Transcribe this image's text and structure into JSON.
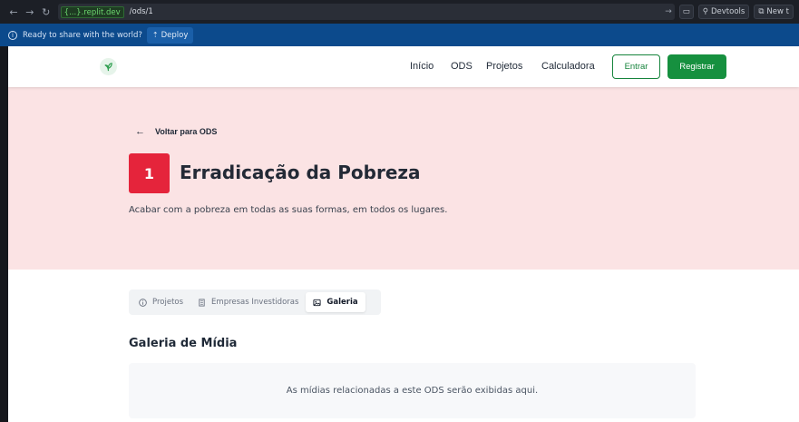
{
  "browser": {
    "domain": "{...}.replit.dev",
    "path": "/ods/1",
    "devtools_label": "Devtools",
    "new_tab_label": "New t"
  },
  "banner": {
    "message": "Ready to share with the world?",
    "deploy_label": "Deploy"
  },
  "nav": {
    "links": [
      "Início",
      "ODS",
      "Projetos",
      "Calculadora"
    ],
    "login_label": "Entrar",
    "register_label": "Registrar"
  },
  "hero": {
    "back_label": "Voltar para ODS",
    "badge_number": "1",
    "title": "Erradicação da Pobreza",
    "description": "Acabar com a pobreza em todas as suas formas, em todos os lugares.",
    "color": "#e5243b"
  },
  "tabs": [
    {
      "label": "Projetos",
      "icon": "info-icon",
      "active": false
    },
    {
      "label": "Empresas Investidoras",
      "icon": "building-icon",
      "active": false
    },
    {
      "label": "Galeria",
      "icon": "image-icon",
      "active": true
    }
  ],
  "gallery": {
    "title": "Galeria de Mídia",
    "empty_message": "As mídias relacionadas a este ODS serão exibidas aqui."
  },
  "colors": {
    "brand_green": "#16903f",
    "hero_bg": "#fbe3e4",
    "banner_bg": "#0c4a8c"
  }
}
